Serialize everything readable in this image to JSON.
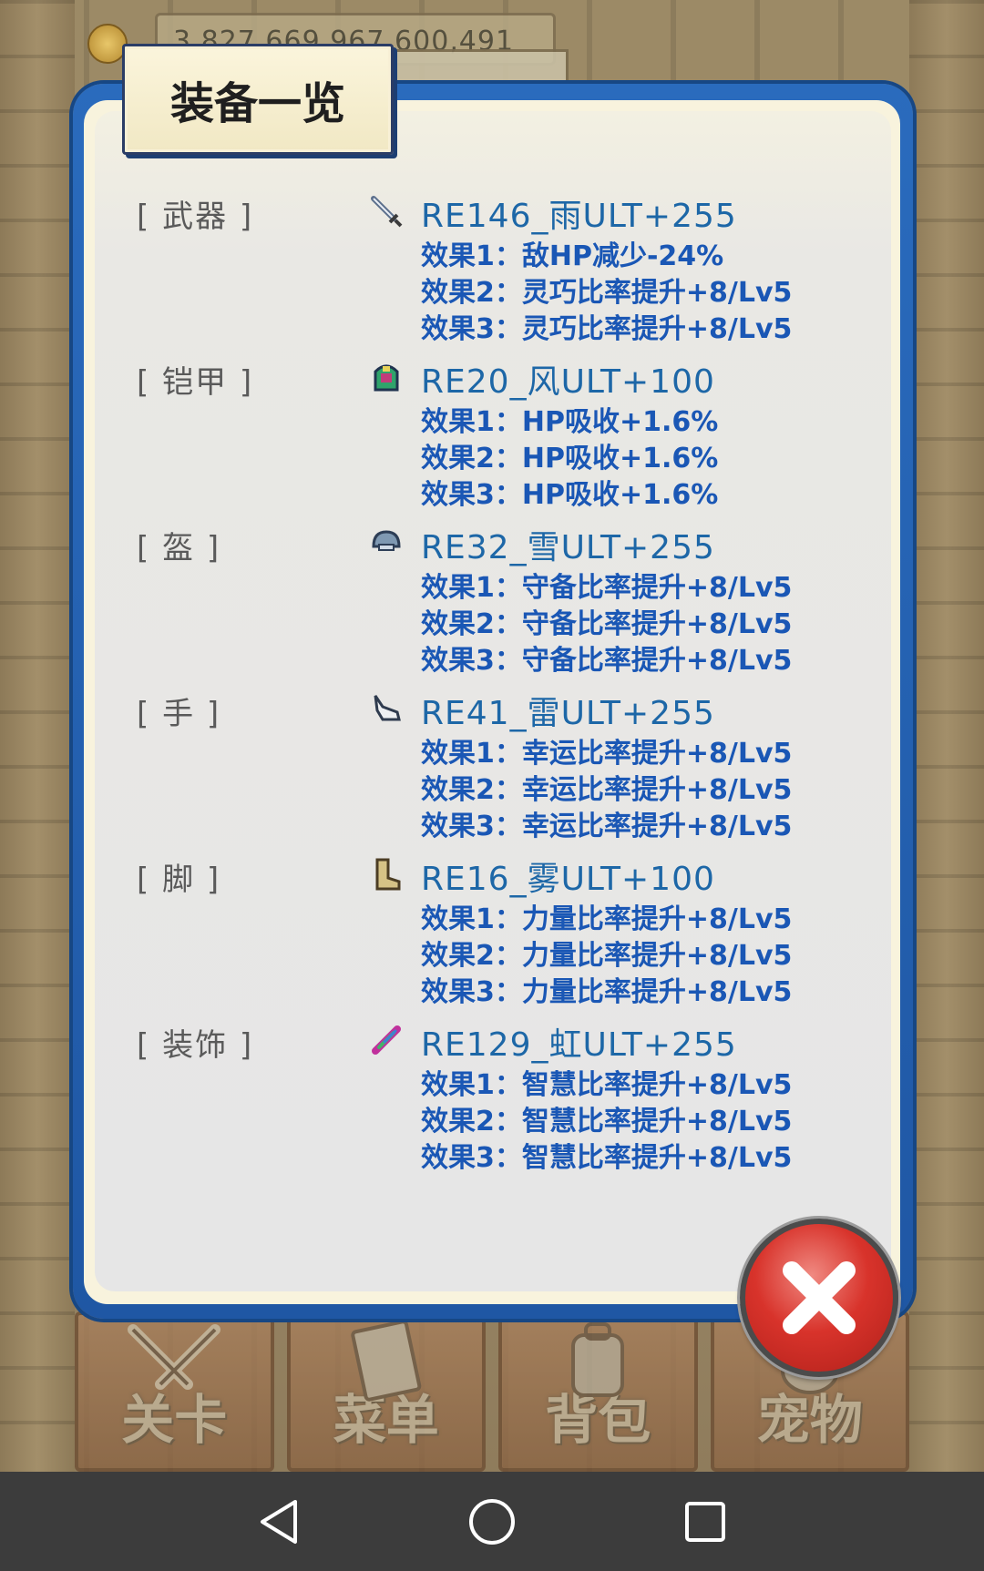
{
  "header": {
    "gold_value": "3,827,669,967,600,491"
  },
  "modal": {
    "title": "装备一览",
    "close_icon": "close-x-icon",
    "colors": {
      "frame": "#2a6bbd",
      "item_name": "#1d67a7",
      "effect": "#1a57b5",
      "close_button": "#d8332b"
    },
    "equipment": [
      {
        "slot": "[ 武器 ]",
        "icon": "sword-icon",
        "name": "RE146_雨ULT+255",
        "effects": [
          "效果1：敌HP减少-24%",
          "效果2：灵巧比率提升+8/Lv5",
          "效果3：灵巧比率提升+8/Lv5"
        ]
      },
      {
        "slot": "[ 铠甲 ]",
        "icon": "armor-icon",
        "name": "RE20_风ULT+100",
        "effects": [
          "效果1：HP吸收+1.6%",
          "效果2：HP吸收+1.6%",
          "效果3：HP吸收+1.6%"
        ]
      },
      {
        "slot": "[ 盔 ]",
        "icon": "helmet-icon",
        "name": "RE32_雪ULT+255",
        "effects": [
          "效果1：守备比率提升+8/Lv5",
          "效果2：守备比率提升+8/Lv5",
          "效果3：守备比率提升+8/Lv5"
        ]
      },
      {
        "slot": "[ 手 ]",
        "icon": "glove-icon",
        "name": "RE41_雷ULT+255",
        "effects": [
          "效果1：幸运比率提升+8/Lv5",
          "效果2：幸运比率提升+8/Lv5",
          "效果3：幸运比率提升+8/Lv5"
        ]
      },
      {
        "slot": "[ 脚 ]",
        "icon": "boot-icon",
        "name": "RE16_雾ULT+100",
        "effects": [
          "效果1：力量比率提升+8/Lv5",
          "效果2：力量比率提升+8/Lv5",
          "效果3：力量比率提升+8/Lv5"
        ]
      },
      {
        "slot": "[ 装饰 ]",
        "icon": "feather-accessory-icon",
        "name": "RE129_虹ULT+255",
        "effects": [
          "效果1：智慧比率提升+8/Lv5",
          "效果2：智慧比率提升+8/Lv5",
          "效果3：智慧比率提升+8/Lv5"
        ]
      }
    ]
  },
  "bottom_nav": {
    "items": [
      {
        "label": "关卡",
        "icon": "crossed-swords-icon"
      },
      {
        "label": "菜单",
        "icon": "book-icon"
      },
      {
        "label": "背包",
        "icon": "backpack-icon"
      },
      {
        "label": "宠物",
        "icon": "pet-icon"
      }
    ]
  },
  "system_nav": {
    "back_icon": "back-triangle-icon",
    "home_icon": "home-circle-icon",
    "recents_icon": "recents-square-icon"
  }
}
